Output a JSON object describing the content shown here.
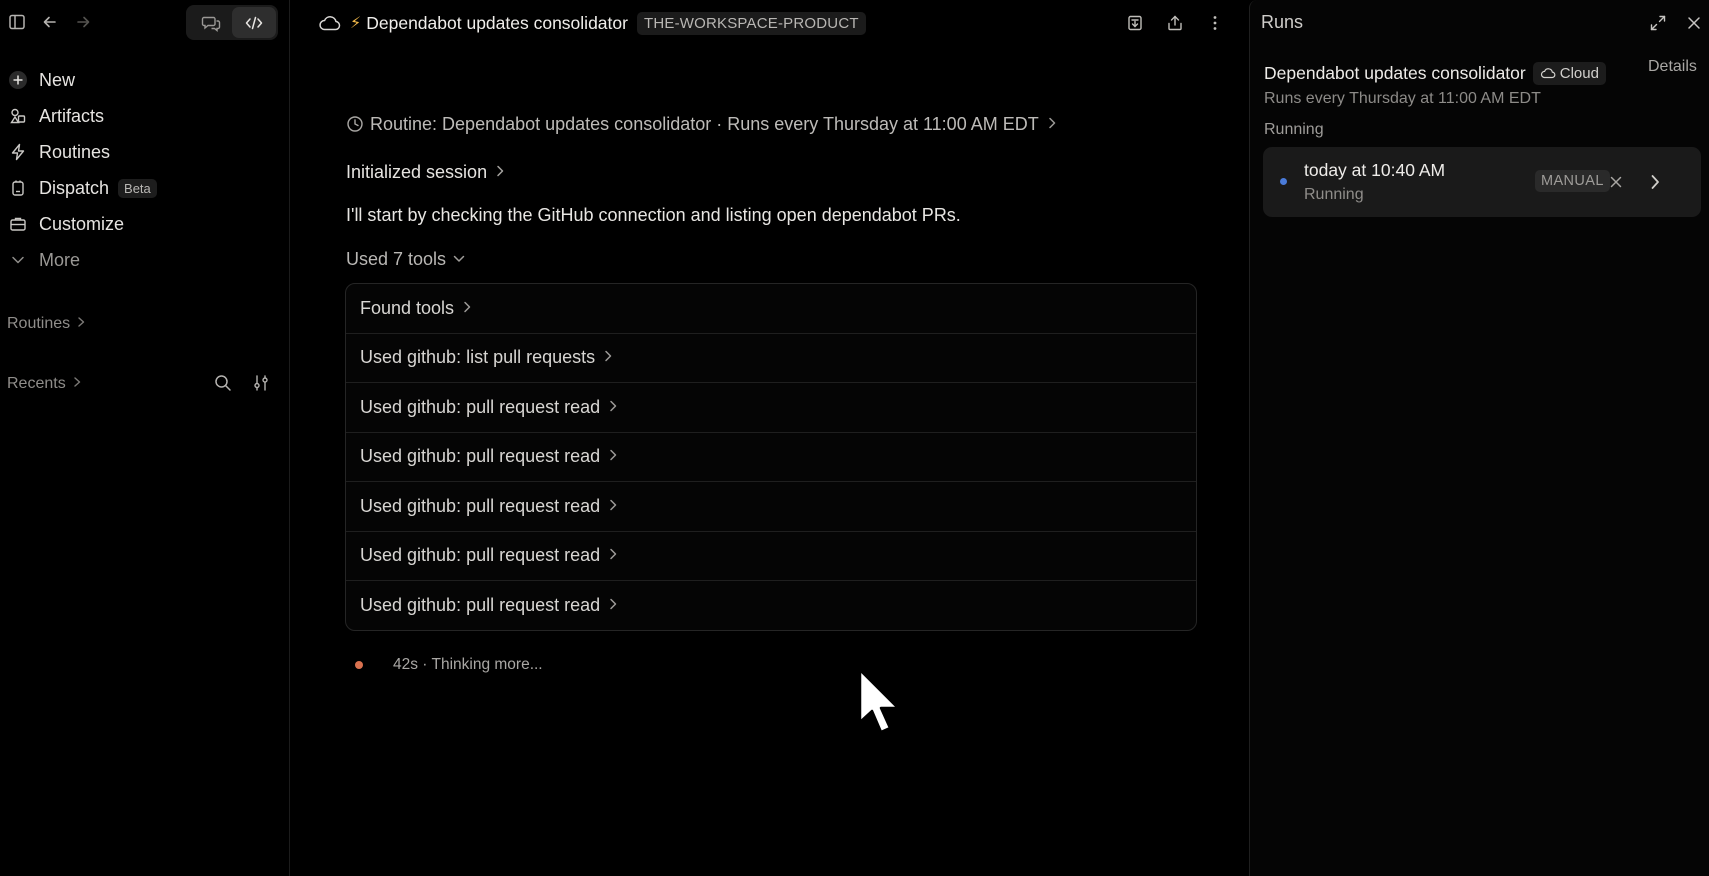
{
  "sidebar": {
    "nav": [
      {
        "label": "New",
        "icon": "plus-icon"
      },
      {
        "label": "Artifacts",
        "icon": "artifacts-icon"
      },
      {
        "label": "Routines",
        "icon": "lightning-icon"
      },
      {
        "label": "Dispatch",
        "icon": "dispatch-icon",
        "badge": "Beta"
      },
      {
        "label": "Customize",
        "icon": "briefcase-icon"
      },
      {
        "label": "More",
        "icon": "chevron-down-icon"
      }
    ],
    "sections": {
      "routines": "Routines",
      "recents": "Recents"
    }
  },
  "header": {
    "title": "Dependabot updates consolidator",
    "workspace": "THE-WORKSPACE-PRODUCT"
  },
  "main": {
    "routine_line": "Routine: Dependabot updates consolidator · Runs every Thursday at 11:00 AM EDT",
    "session_line": "Initialized session",
    "message": "I'll start by checking the GitHub connection and listing open dependabot PRs.",
    "used_tools_label": "Used 7 tools",
    "tools": [
      "Found tools",
      "Used github: list pull requests",
      "Used github: pull request read",
      "Used github: pull request read",
      "Used github: pull request read",
      "Used github: pull request read",
      "Used github: pull request read"
    ],
    "thinking": "42s · Thinking more..."
  },
  "runs_panel": {
    "header": "Runs",
    "title": "Dependabot updates consolidator",
    "cloud_badge": "Cloud",
    "details": "Details",
    "schedule": "Runs every Thursday at 11:00 AM EDT",
    "status": "Running",
    "run": {
      "time": "today at 10:40 AM",
      "state": "Running",
      "badge": "MANUAL"
    }
  },
  "colors": {
    "background": "#000000",
    "accent_bolt": "#f1b84a",
    "thinking_dot": "#d9714f",
    "run_dot": "#4a7bd9"
  }
}
